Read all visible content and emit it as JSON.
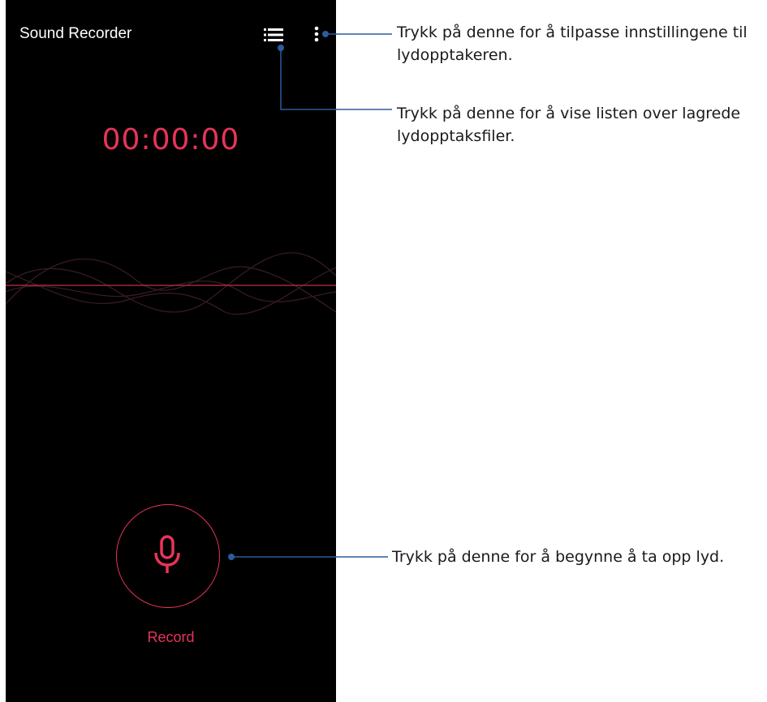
{
  "app": {
    "title": "Sound Recorder",
    "timer": "00:00:00",
    "record_label": "Record"
  },
  "icons": {
    "list": "list-icon",
    "more": "more-vert-icon",
    "mic": "microphone-icon"
  },
  "colors": {
    "background": "#000000",
    "accent": "#e8345a",
    "callout_line": "#2b5c9c",
    "text_light": "#ffffff"
  },
  "callouts": [
    {
      "text": "Trykk på denne for å tilpasse innstillingene til lydopptakeren."
    },
    {
      "text": "Trykk på denne for å vise listen over lagrede lydopptaksfiler."
    },
    {
      "text": "Trykk på denne for å begynne å ta opp lyd."
    }
  ]
}
